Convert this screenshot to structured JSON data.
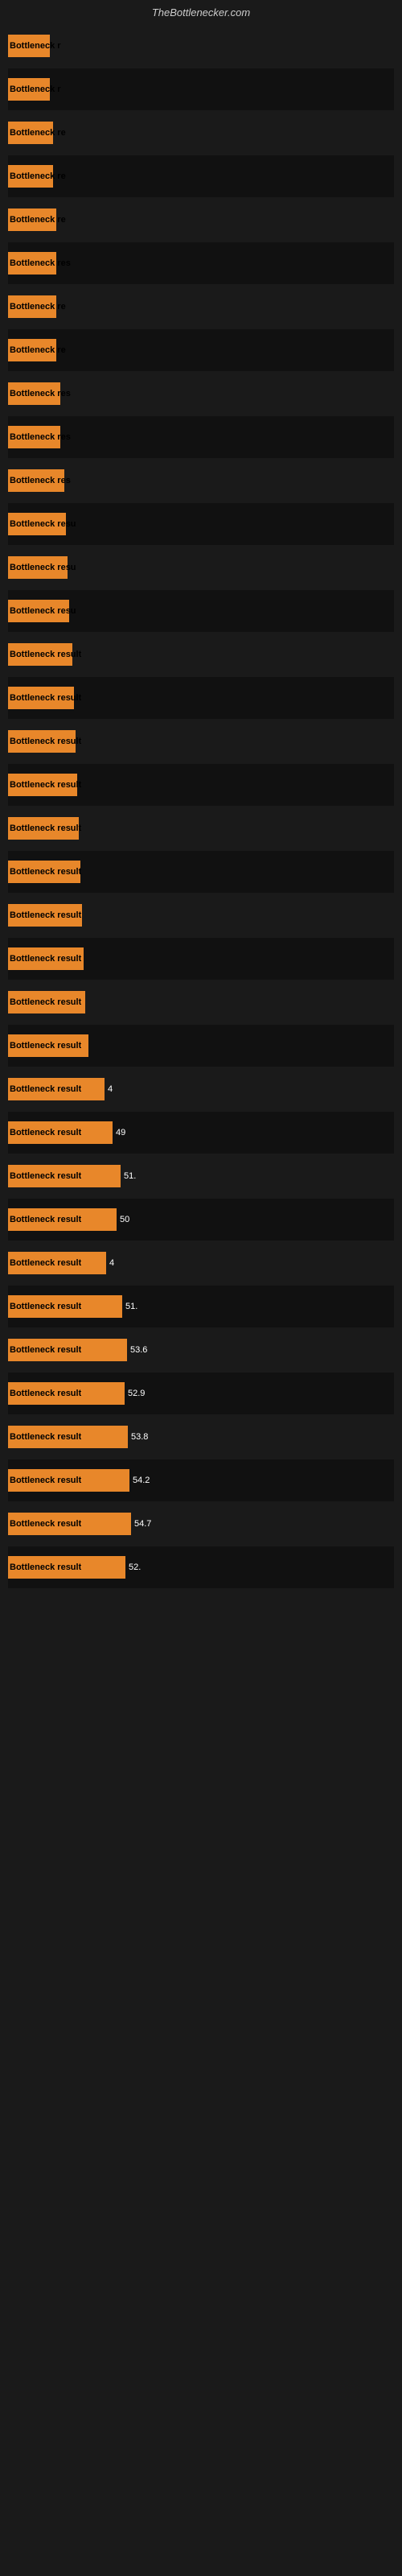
{
  "header": {
    "title": "TheBottlenecker.com"
  },
  "bars": [
    {
      "label": "Bottleneck r",
      "width": 52,
      "value": null
    },
    {
      "label": "Bottleneck r",
      "width": 52,
      "value": null
    },
    {
      "label": "Bottleneck re",
      "width": 56,
      "value": null
    },
    {
      "label": "Bottleneck re",
      "width": 56,
      "value": null
    },
    {
      "label": "Bottleneck re",
      "width": 60,
      "value": null
    },
    {
      "label": "Bottleneck res",
      "width": 60,
      "value": null
    },
    {
      "label": "Bottleneck re",
      "width": 60,
      "value": null
    },
    {
      "label": "Bottleneck re",
      "width": 60,
      "value": null
    },
    {
      "label": "Bottleneck res",
      "width": 65,
      "value": null
    },
    {
      "label": "Bottleneck res",
      "width": 65,
      "value": null
    },
    {
      "label": "Bottleneck res",
      "width": 70,
      "value": null
    },
    {
      "label": "Bottleneck resu",
      "width": 72,
      "value": null
    },
    {
      "label": "Bottleneck resu",
      "width": 74,
      "value": null
    },
    {
      "label": "Bottleneck resu",
      "width": 76,
      "value": null
    },
    {
      "label": "Bottleneck result",
      "width": 80,
      "value": null
    },
    {
      "label": "Bottleneck result",
      "width": 82,
      "value": null
    },
    {
      "label": "Bottleneck result",
      "width": 84,
      "value": null
    },
    {
      "label": "Bottleneck result",
      "width": 86,
      "value": null
    },
    {
      "label": "Bottleneck result",
      "width": 88,
      "value": null
    },
    {
      "label": "Bottleneck result",
      "width": 90,
      "value": null
    },
    {
      "label": "Bottleneck result",
      "width": 92,
      "value": null
    },
    {
      "label": "Bottleneck result",
      "width": 94,
      "value": null
    },
    {
      "label": "Bottleneck result",
      "width": 96,
      "value": null
    },
    {
      "label": "Bottleneck result",
      "width": 100,
      "value": null
    },
    {
      "label": "Bottleneck result",
      "width": 120,
      "value": "4"
    },
    {
      "label": "Bottleneck result",
      "width": 130,
      "value": "49"
    },
    {
      "label": "Bottleneck result",
      "width": 140,
      "value": "51."
    },
    {
      "label": "Bottleneck result",
      "width": 135,
      "value": "50"
    },
    {
      "label": "Bottleneck result",
      "width": 122,
      "value": "4"
    },
    {
      "label": "Bottleneck result",
      "width": 142,
      "value": "51."
    },
    {
      "label": "Bottleneck result",
      "width": 148,
      "value": "53.6"
    },
    {
      "label": "Bottleneck result",
      "width": 145,
      "value": "52.9"
    },
    {
      "label": "Bottleneck result",
      "width": 149,
      "value": "53.8"
    },
    {
      "label": "Bottleneck result",
      "width": 151,
      "value": "54.2"
    },
    {
      "label": "Bottleneck result",
      "width": 153,
      "value": "54.7"
    },
    {
      "label": "Bottleneck result",
      "width": 146,
      "value": "52."
    }
  ]
}
